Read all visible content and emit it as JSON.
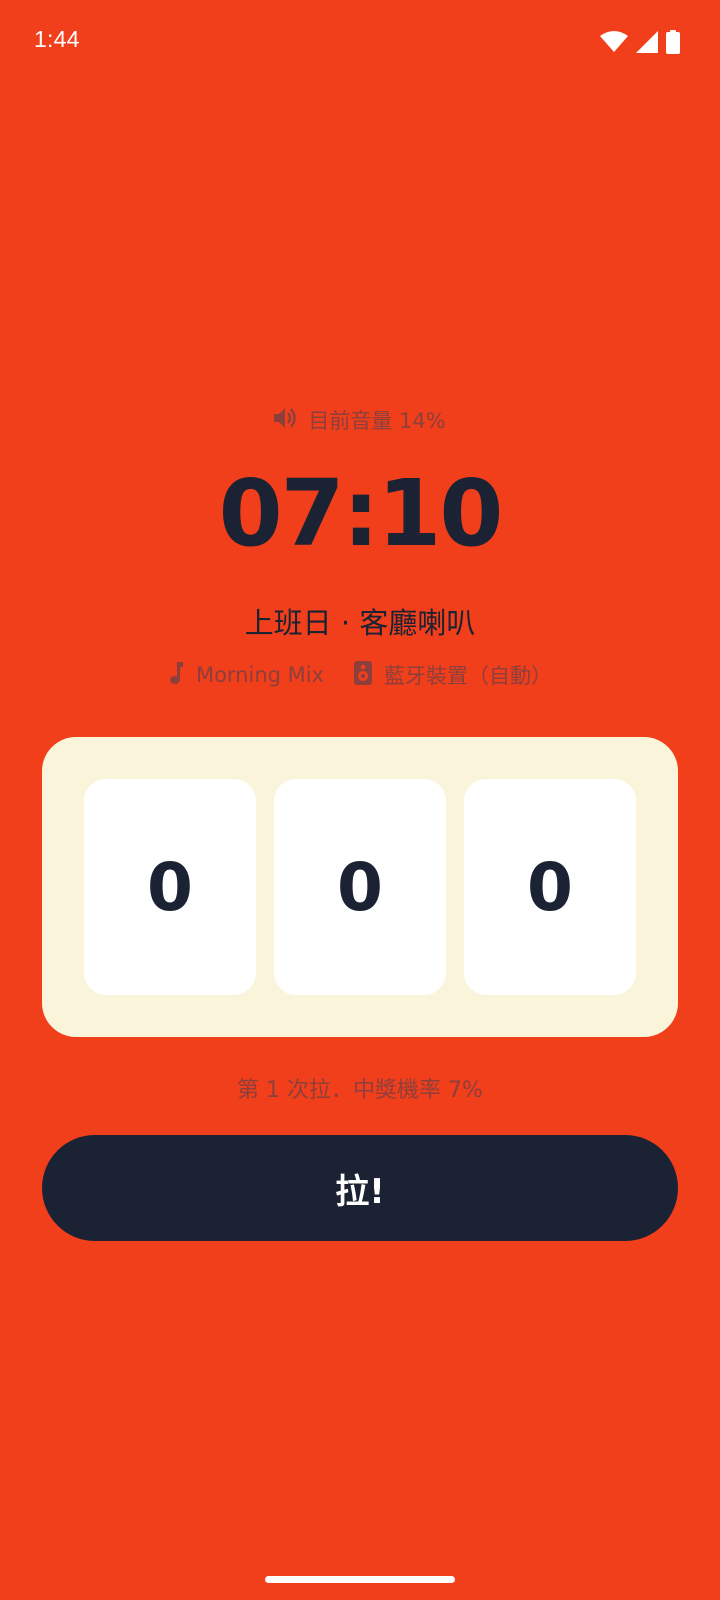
{
  "status_bar": {
    "time": "1:44",
    "icons": [
      "wifi-icon",
      "cellular-signal-icon",
      "battery-icon"
    ]
  },
  "alarm": {
    "volume_text": "目前音量 14%",
    "time": "07:10",
    "name": "上班日 · 客廳喇叭",
    "music": "Morning Mix",
    "device": "藍牙裝置（自動）"
  },
  "slots": {
    "values": [
      "0",
      "0",
      "0"
    ]
  },
  "chance_text": "第 1 次拉．中獎機率 7%",
  "pull_button_label": "拉!",
  "colors": {
    "background": "#F03F1A",
    "panel": "#FAF5DA",
    "slot": "#FFFFFF",
    "dark": "#1A2233",
    "muted_text": "#8D3F3C"
  }
}
